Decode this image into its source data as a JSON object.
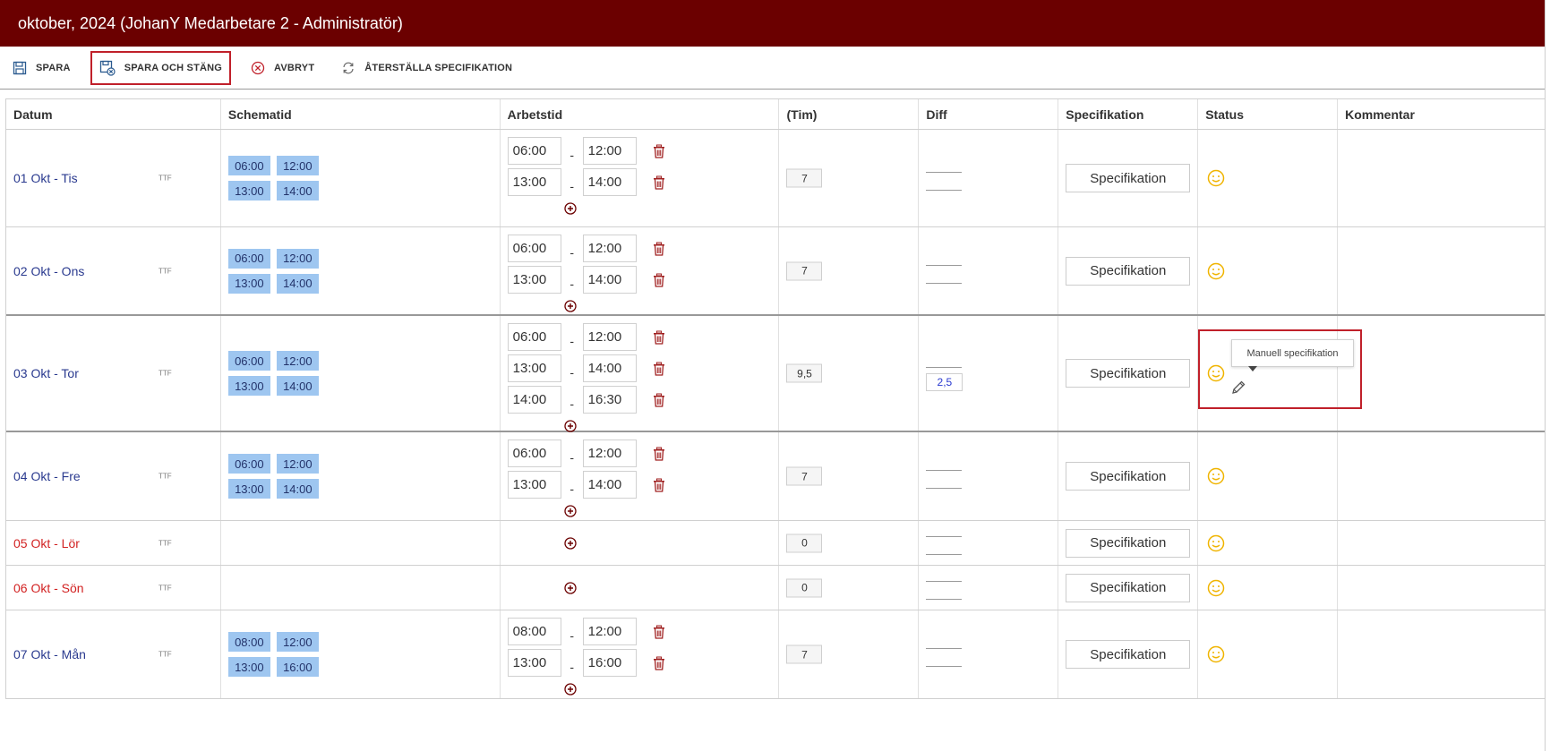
{
  "window": {
    "title": "oktober, 2024 (JohanY Medarbetare 2 - Administratör)"
  },
  "toolbar": {
    "save": "SPARA",
    "save_close": "SPARA OCH STÄNG",
    "cancel": "AVBRYT",
    "reset": "ÅTERSTÄLLA SPECIFIKATION"
  },
  "columns": {
    "datum": "Datum",
    "schematid": "Schematid",
    "arbetstid": "Arbetstid",
    "tim": "(Tim)",
    "diff": "Diff",
    "specifikation": "Specifikation",
    "status": "Status",
    "kommentar": "Kommentar"
  },
  "tooltip": "Manuell specifikation",
  "colors": {
    "brand": "#6b0000",
    "chip": "#9ec6f0",
    "weekend": "#d22222",
    "smile": "#f0b400",
    "highlight": "#c0202a"
  },
  "rows": [
    {
      "date": "01 Okt - Tis",
      "tag": "TTF",
      "weekend": false,
      "schedule": [
        "06:00",
        "12:00",
        "13:00",
        "14:00"
      ],
      "work": [
        {
          "from": "06:00",
          "to": "12:00"
        },
        {
          "from": "13:00",
          "to": "14:00"
        }
      ],
      "hours": "7",
      "diff": "",
      "spec": "Specifikation",
      "status_icon": "smile-icon"
    },
    {
      "date": "02 Okt - Ons",
      "tag": "TTF",
      "weekend": false,
      "schedule": [
        "06:00",
        "12:00",
        "13:00",
        "14:00"
      ],
      "work": [
        {
          "from": "06:00",
          "to": "12:00"
        },
        {
          "from": "13:00",
          "to": "14:00"
        }
      ],
      "hours": "7",
      "diff": "",
      "spec": "Specifikation",
      "status_icon": "smile-icon"
    },
    {
      "date": "03 Okt - Tor",
      "tag": "TTF",
      "weekend": false,
      "schedule": [
        "06:00",
        "12:00",
        "13:00",
        "14:00"
      ],
      "work": [
        {
          "from": "06:00",
          "to": "12:00"
        },
        {
          "from": "13:00",
          "to": "14:00"
        },
        {
          "from": "14:00",
          "to": "16:30"
        }
      ],
      "hours": "9,5",
      "diff": "2,5",
      "spec": "Specifikation",
      "status_icon": "smile-icon"
    },
    {
      "date": "04 Okt - Fre",
      "tag": "TTF",
      "weekend": false,
      "schedule": [
        "06:00",
        "12:00",
        "13:00",
        "14:00"
      ],
      "work": [
        {
          "from": "06:00",
          "to": "12:00"
        },
        {
          "from": "13:00",
          "to": "14:00"
        }
      ],
      "hours": "7",
      "diff": "",
      "spec": "Specifikation",
      "status_icon": "smile-icon"
    },
    {
      "date": "05 Okt - Lör",
      "tag": "TTF",
      "weekend": true,
      "schedule": [],
      "work": [],
      "hours": "0",
      "diff": "",
      "spec": "Specifikation",
      "status_icon": "smile-icon"
    },
    {
      "date": "06 Okt - Sön",
      "tag": "TTF",
      "weekend": true,
      "schedule": [],
      "work": [],
      "hours": "0",
      "diff": "",
      "spec": "Specifikation",
      "status_icon": "smile-icon"
    },
    {
      "date": "07 Okt - Mån",
      "tag": "TTF",
      "weekend": false,
      "schedule": [
        "08:00",
        "12:00",
        "13:00",
        "16:00"
      ],
      "work": [
        {
          "from": "08:00",
          "to": "12:00"
        },
        {
          "from": "13:00",
          "to": "16:00"
        }
      ],
      "hours": "7",
      "diff": "",
      "spec": "Specifikation",
      "status_icon": "smile-icon"
    }
  ]
}
